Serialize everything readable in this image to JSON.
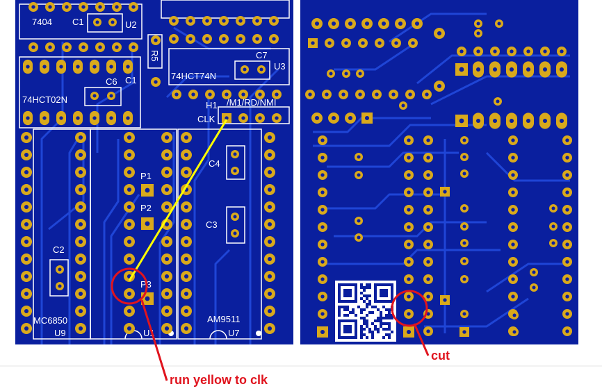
{
  "colors": {
    "board_bg": "#0a1f9e",
    "trace": "#1f45d6",
    "pad": "#d9a91c",
    "silkscreen": "#ffffff",
    "annotation": "#e0141e",
    "wire": "#ffff00",
    "page_bg": "#ffffff"
  },
  "left_board": {
    "labels": {
      "ic_7404": "7404",
      "c1": "C1",
      "u2": "U2",
      "r5": "R5",
      "c7": "C7",
      "u3": "U3",
      "ic_74hct74n": "74HCT74N",
      "c6": "C6",
      "c_partial": "C1",
      "ic_74hct02n": "74HCT02N",
      "h1": "H1",
      "clk": "CLK",
      "header_pins": "/M1/RD/NMI",
      "c4": "C4",
      "p1": "P1",
      "p2": "P2",
      "c3": "C3",
      "c2": "C2",
      "p3": "P3",
      "mc6850": "MC6850",
      "u9": "U9",
      "u1": "U1",
      "am9511": "AM9511",
      "u7": "U7"
    }
  },
  "right_board": {
    "has_qr_code": true
  },
  "annotations": {
    "cut_label": "cut",
    "run_yellow_label": "run yellow to clk"
  }
}
